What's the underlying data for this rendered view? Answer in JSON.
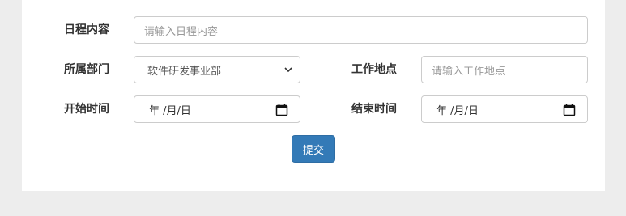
{
  "form": {
    "schedule_content": {
      "label": "日程内容",
      "placeholder": "请输入日程内容"
    },
    "department": {
      "label": "所属部门",
      "selected": "软件研发事业部"
    },
    "work_location": {
      "label": "工作地点",
      "placeholder": "请输入工作地点"
    },
    "start_time": {
      "label": "开始时间",
      "value": "年 /月/日"
    },
    "end_time": {
      "label": "结束时间",
      "value": "年 /月/日"
    },
    "submit_label": "提交"
  },
  "colors": {
    "primary_button": "#337ab7",
    "page_background": "#ededed",
    "panel_background": "#ffffff"
  }
}
